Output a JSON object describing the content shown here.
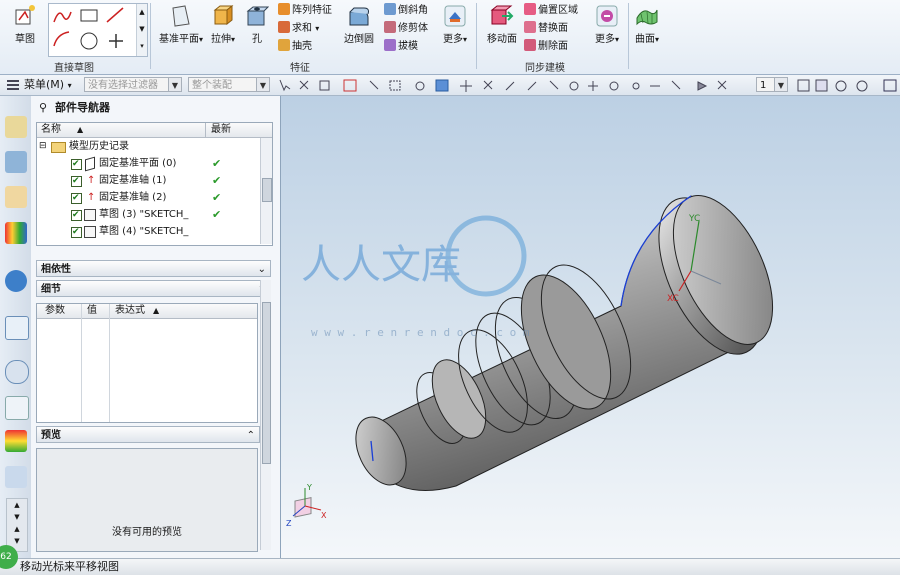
{
  "ribbon": {
    "sketch_label": "草图",
    "sketch_group_label": "直接草图",
    "datum_plane_label": "基准平面",
    "extrude_label": "拉伸",
    "hole_label": "孔",
    "pattern_feature_label": "阵列特征",
    "unite_label": "求和",
    "shell_label": "抽壳",
    "edge_blend_label": "边倒圆",
    "chamfer_label": "倒斜角",
    "trim_body_label": "修剪体",
    "draft_label": "拔模",
    "more_label_1": "更多",
    "feature_group_label": "特征",
    "move_face_label": "移动面",
    "offset_region_label": "偏置区域",
    "replace_face_label": "替换面",
    "delete_face_label": "删除面",
    "more_label_2": "更多",
    "sync_group_label": "同步建模",
    "surface_label": "曲面"
  },
  "toolbar": {
    "menu_label": "菜单(M)",
    "filter_placeholder": "没有选择过滤器",
    "assembly_placeholder": "整个装配",
    "layer_value": "1"
  },
  "navigator": {
    "title": "部件导航器",
    "col_name": "名称",
    "col_latest": "最新",
    "root_label": "模型历史记录",
    "rows": [
      {
        "label": "固定基准平面 (0)"
      },
      {
        "label": "固定基准轴 (1)"
      },
      {
        "label": "固定基准轴 (2)"
      },
      {
        "label": "草图 (3) \"SKETCH_"
      },
      {
        "label": "草图 (4) \"SKETCH_"
      }
    ],
    "dependencies_label": "相依性",
    "details_label": "细节",
    "details_cols": [
      "参数",
      "值",
      "表达式"
    ],
    "preview_label": "预览",
    "preview_empty": "没有可用的预览"
  },
  "viewport": {
    "axis_yc": "YC",
    "axis_xc": "XC",
    "mini_axis_y": "Y",
    "mini_axis_x": "X",
    "mini_axis_z": "Z",
    "watermark_text": "人人文库",
    "watermark_url": "w w w . r e n r e n d o c . c o m"
  },
  "status": {
    "message": "移动光标来平移视图",
    "badge": "62"
  }
}
